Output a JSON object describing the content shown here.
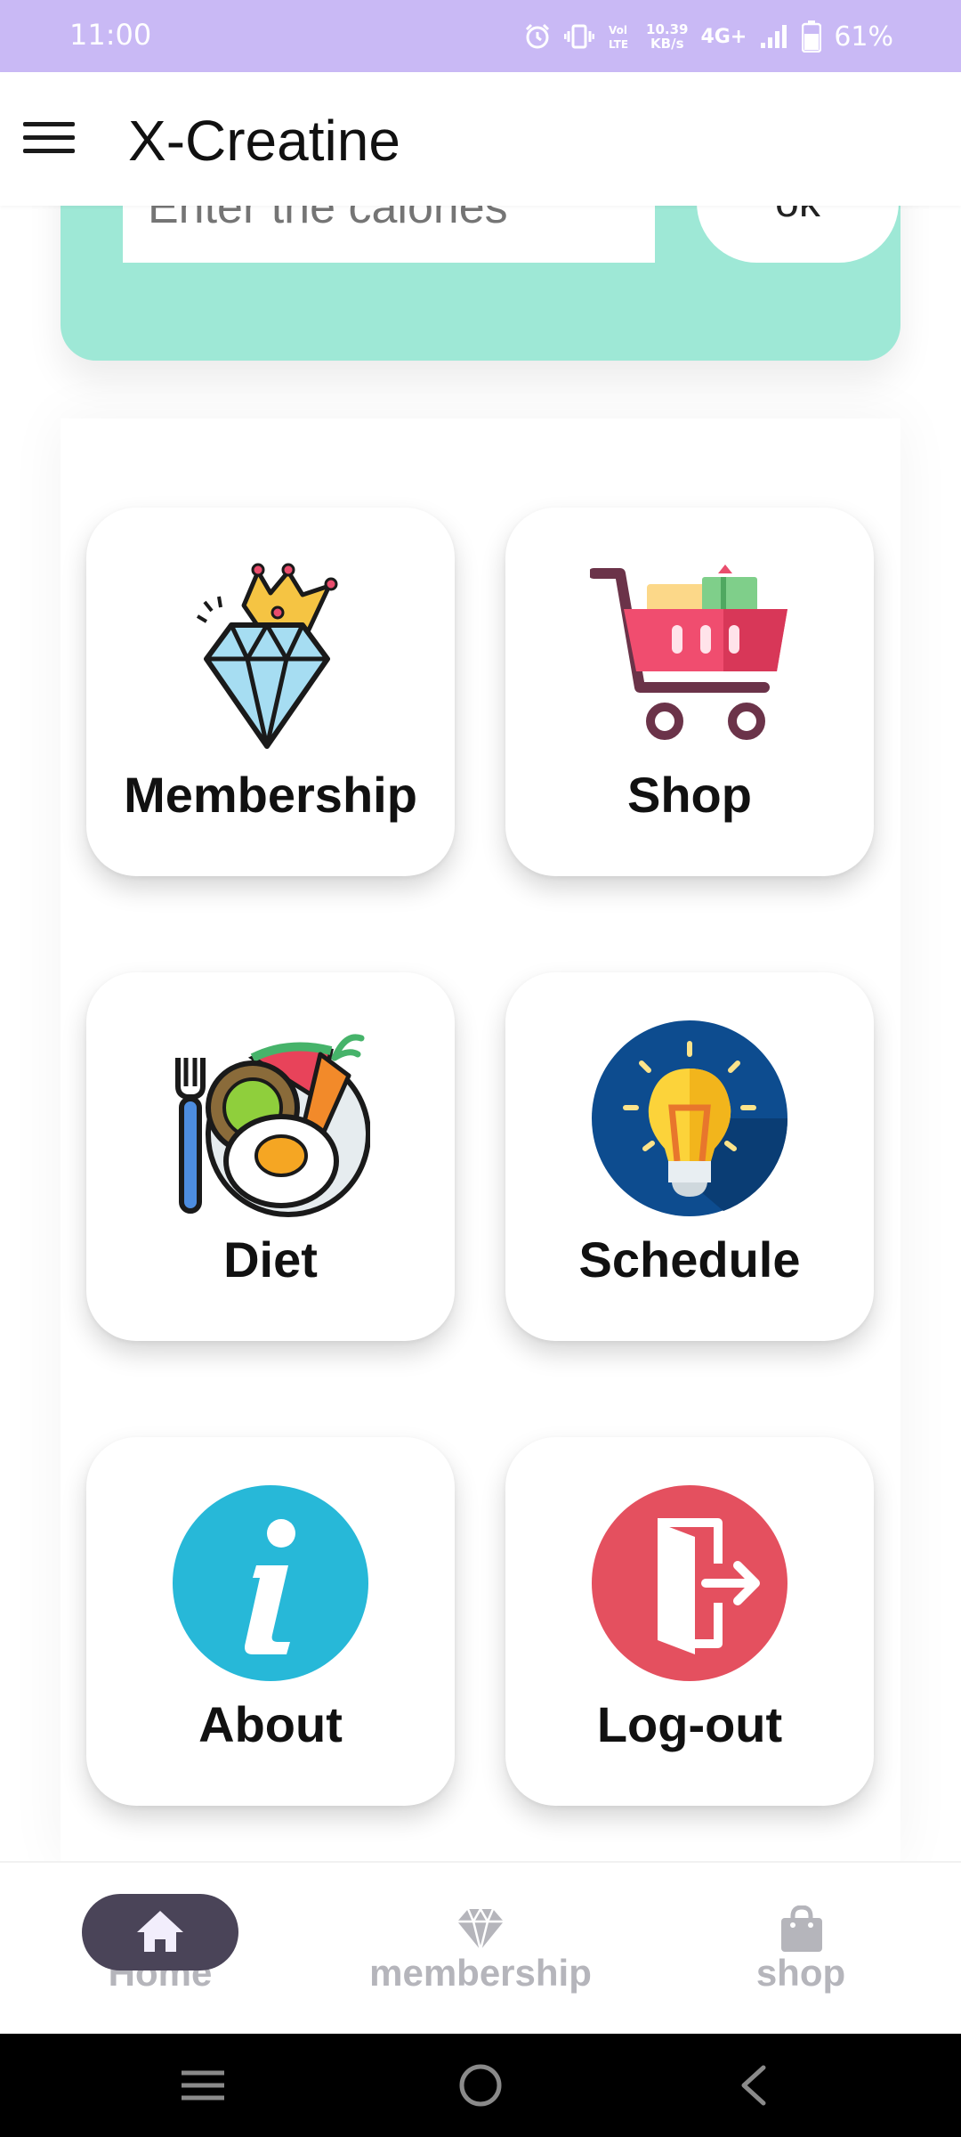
{
  "status_bar": {
    "time": "11:00",
    "speed_value": "10.39",
    "speed_unit": "KB/s",
    "network": "4G+",
    "battery": "61%",
    "icons": [
      "alarm-icon",
      "vibrate-icon",
      "volte-icon",
      "signal-icon",
      "battery-icon"
    ]
  },
  "app_bar": {
    "title": "X-Creatine",
    "menu_icon": "hamburger-menu-icon"
  },
  "calorie_card": {
    "input_placeholder": "Enter the calories",
    "ok_label": "ok"
  },
  "tiles": [
    {
      "label": "Membership",
      "icon": "diamond-crown-icon"
    },
    {
      "label": "Shop",
      "icon": "shopping-cart-icon"
    },
    {
      "label": "Diet",
      "icon": "meal-plate-icon"
    },
    {
      "label": "Schedule",
      "icon": "light-bulb-icon"
    },
    {
      "label": "About",
      "icon": "info-icon"
    },
    {
      "label": "Log-out",
      "icon": "exit-door-icon"
    }
  ],
  "bottom_nav": {
    "items": [
      {
        "label": "Home",
        "icon": "home-icon",
        "active": true
      },
      {
        "label": "membership",
        "icon": "diamond-icon",
        "active": false
      },
      {
        "label": "shop",
        "icon": "shopping-bag-icon",
        "active": false
      }
    ]
  },
  "colors": {
    "status_bar": "#c9b9f5",
    "calorie_card": "#9ee8d6",
    "nav_pill": "#4a4458",
    "nav_inactive": "#b5b5bb"
  }
}
